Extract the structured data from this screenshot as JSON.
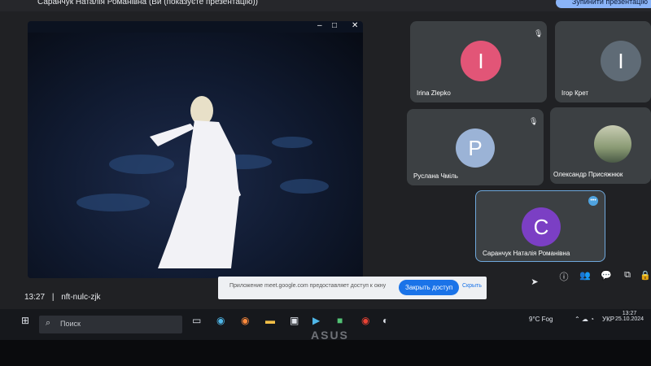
{
  "window": {
    "title": "Саранчук Наталія Романівна (Ви (показуєте презентацію))",
    "present_button": "Зупинити\nпрезентацію"
  },
  "stage": {
    "controls": [
      "–",
      "□",
      "✕"
    ]
  },
  "participants": [
    {
      "name": "Irina Zlepko",
      "initial": "I",
      "color": "#e25577",
      "muted": true
    },
    {
      "name": "Ігор Крет",
      "initial": "I",
      "color": "#5f6b76",
      "muted": false
    },
    {
      "name": "Руслана Чміль",
      "initial": "P",
      "color": "#9bb3d6",
      "muted": true
    },
    {
      "name": "Олександр Присяжнюк",
      "initial": "",
      "color": "#7f8f7f",
      "muted": false,
      "photo": true
    },
    {
      "name": "Саранчук Наталія Романівна",
      "initial": "C",
      "color": "#7b3fc4",
      "muted": false,
      "active": true
    }
  ],
  "meeting": {
    "time": "13:27",
    "separator": "|",
    "code": "nft-nulc-zjk"
  },
  "notification": {
    "text": "Приложение meet.google.com предоставляет доступ к окну",
    "share_label": "Закрыть доступ",
    "hide_label": "Скрыть"
  },
  "control_icons": [
    "info-icon",
    "people-icon",
    "chat-icon",
    "activities-icon",
    "lock-icon"
  ],
  "taskbar": {
    "search_placeholder": "Поиск",
    "weather": "9°C Fog",
    "language": "УКР",
    "clock_time": "13:27",
    "clock_date": "25.10.2024"
  },
  "brand": "ASUS"
}
